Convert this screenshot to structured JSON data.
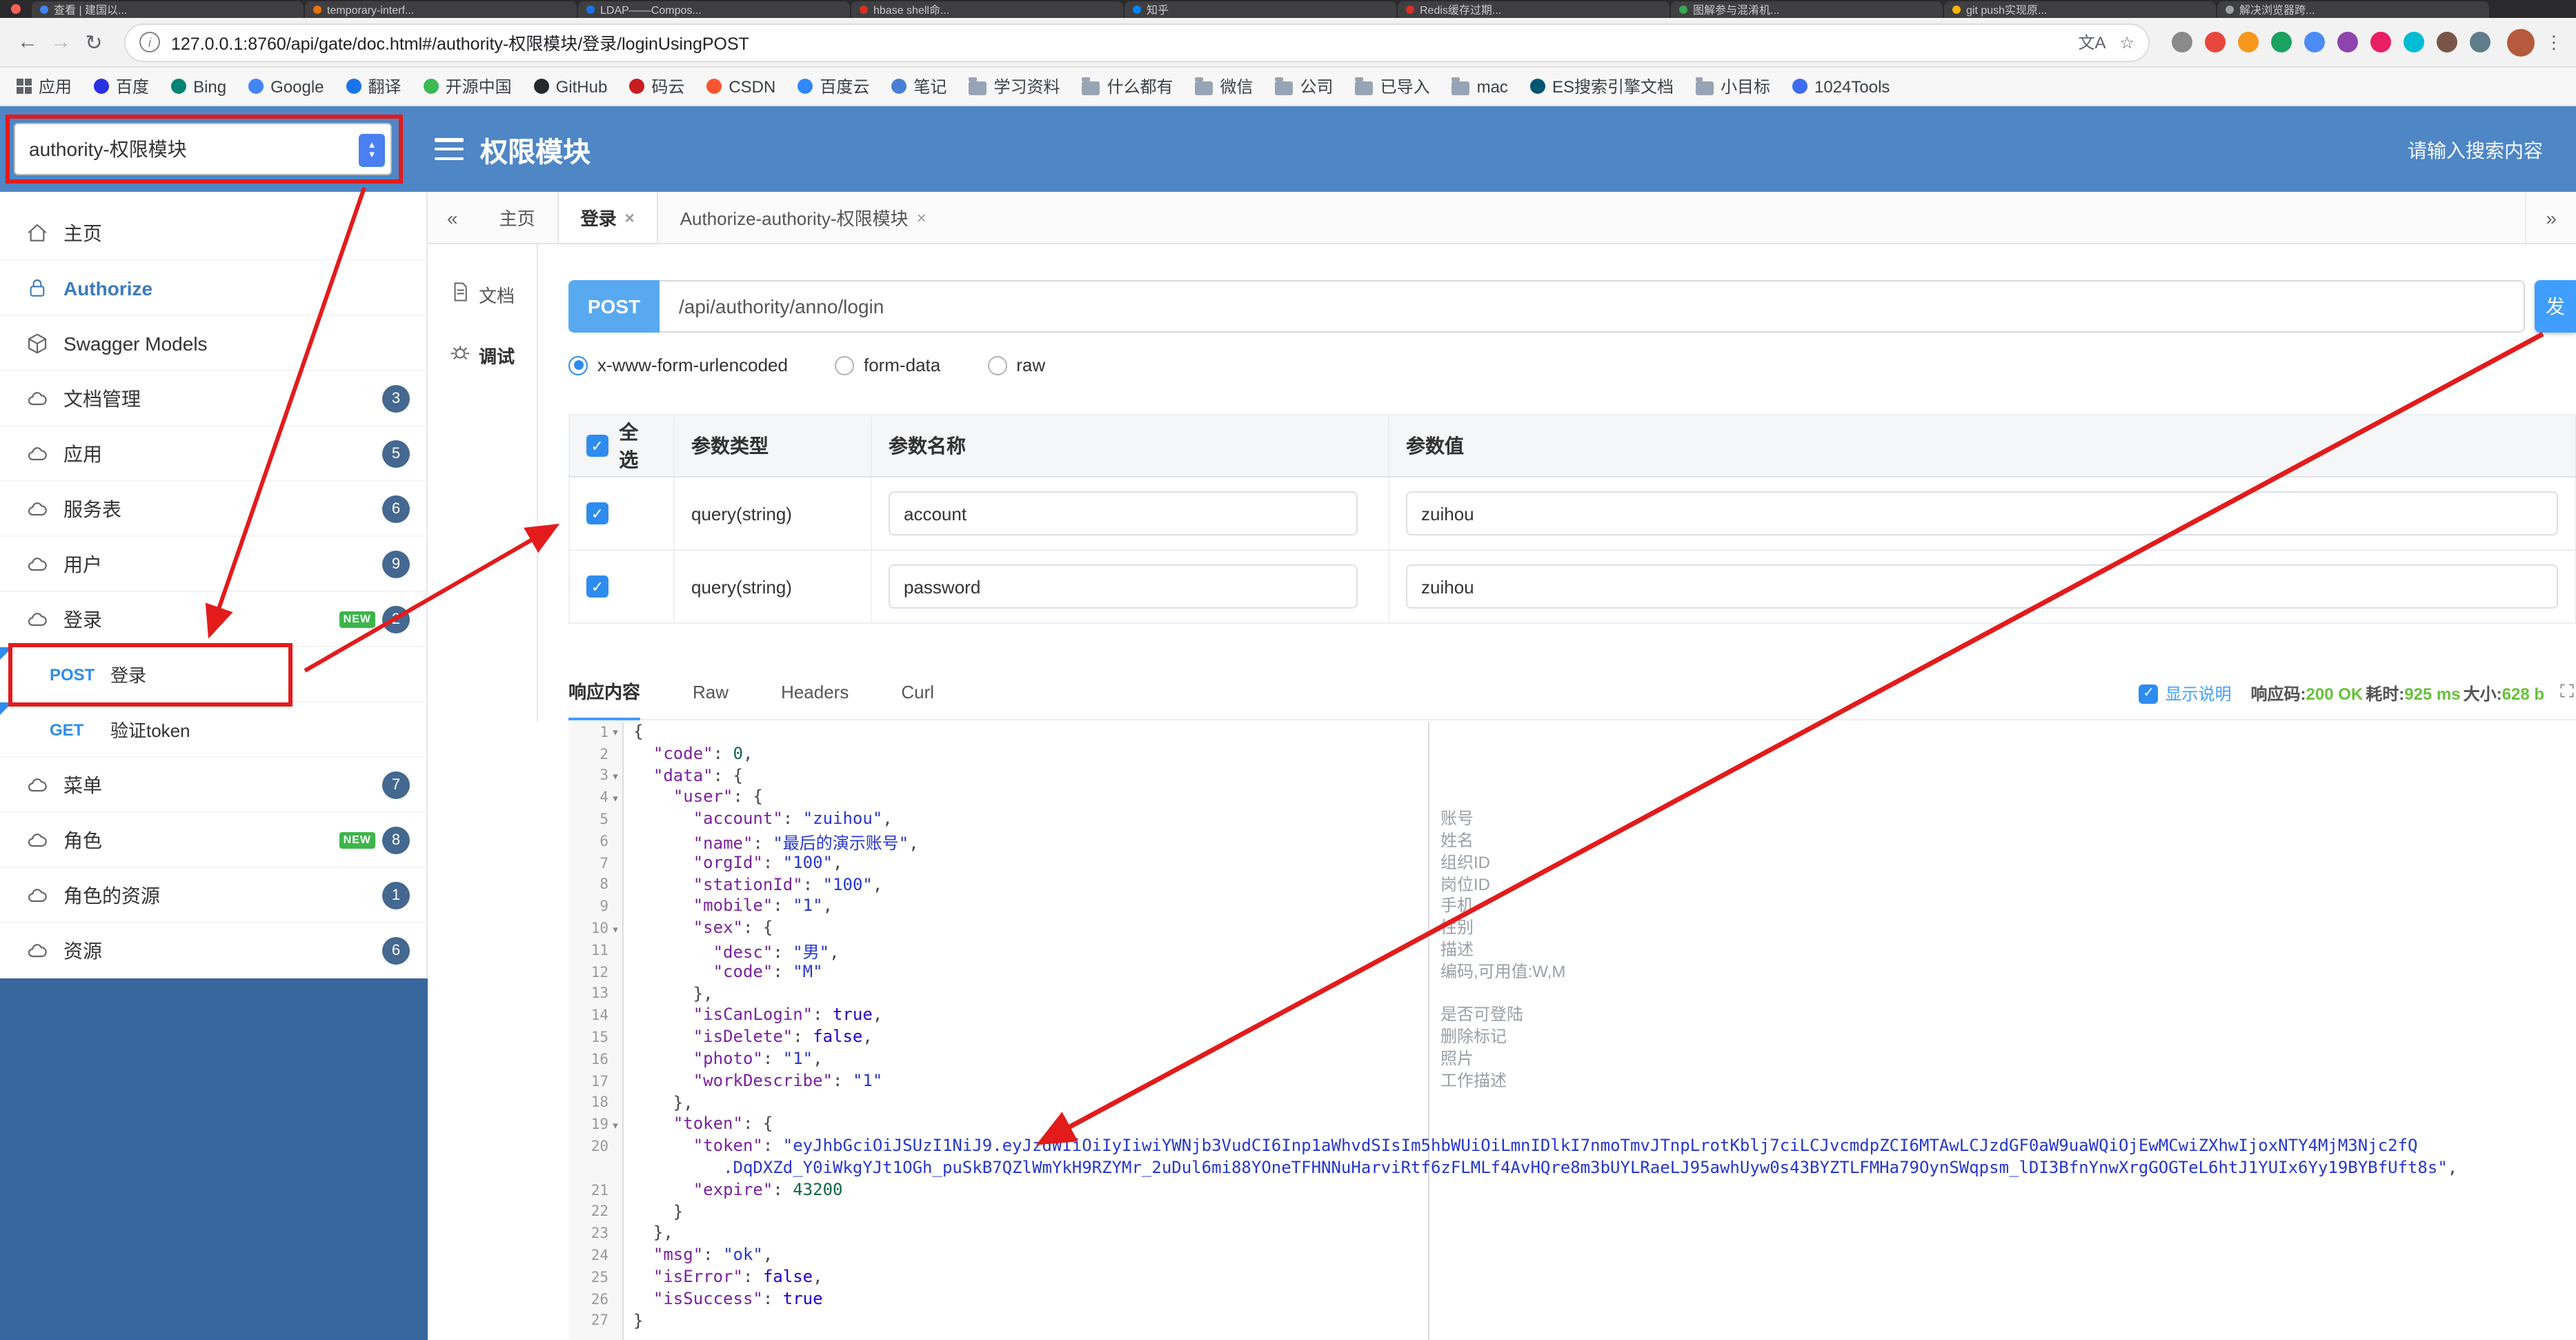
{
  "colors": {
    "header_blue": "#4e86c6",
    "sidebar_footer_blue": "#38679e",
    "accent_blue": "#409eff",
    "method_blue": "#2d8cf0",
    "success_green": "#67c23a",
    "annotation_red": "#e31b1b",
    "badge_blue": "#44688f",
    "new_green": "#3cb54a"
  },
  "browser": {
    "tabs": [
      {
        "title": "查看 | 建国以...",
        "color": "#4285f4"
      },
      {
        "title": "temporary-interf...",
        "color": "#e8710a"
      },
      {
        "title": "LDAP——Compos...",
        "color": "#1a73e8"
      },
      {
        "title": "hbase shell命...",
        "color": "#d93025"
      },
      {
        "title": "知乎",
        "color": "#0084ff"
      },
      {
        "title": "Redis缓存过期...",
        "color": "#d93025"
      },
      {
        "title": "图解参与混淆机...",
        "color": "#34a853"
      },
      {
        "title": "git push实现原...",
        "color": "#f4b400"
      },
      {
        "title": "解决浏览器跨...",
        "color": "#9aa0a6"
      }
    ],
    "address": {
      "url": "127.0.0.1:8760/api/gate/doc.html#/authority-权限模块/登录/loginUsingPOST"
    },
    "extensions": [
      "#8a8a8a",
      "#e8453c",
      "#f7981d",
      "#1aa260",
      "#4c8bf5",
      "#8e44ad",
      "#e91e63",
      "#00bcd4",
      "#795548",
      "#607d8b"
    ],
    "bookmarks": [
      {
        "label": "应用",
        "type": "apps"
      },
      {
        "label": "百度",
        "type": "site",
        "color": "#2932e1"
      },
      {
        "label": "Bing",
        "type": "site",
        "color": "#008373"
      },
      {
        "label": "Google",
        "type": "site",
        "color": "#4285f4"
      },
      {
        "label": "翻译",
        "type": "site",
        "color": "#1a73e8"
      },
      {
        "label": "开源中国",
        "type": "site",
        "color": "#3db954"
      },
      {
        "label": "GitHub",
        "type": "site",
        "color": "#24292e"
      },
      {
        "label": "码云",
        "type": "site",
        "color": "#c71d23"
      },
      {
        "label": "CSDN",
        "type": "site",
        "color": "#fc5531"
      },
      {
        "label": "百度云",
        "type": "site",
        "color": "#2f88ff"
      },
      {
        "label": "笔记",
        "type": "site",
        "color": "#4a7fd4"
      },
      {
        "label": "学习资料",
        "type": "folder"
      },
      {
        "label": "什么都有",
        "type": "folder"
      },
      {
        "label": "微信",
        "type": "folder"
      },
      {
        "label": "公司",
        "type": "folder"
      },
      {
        "label": "已导入",
        "type": "folder"
      },
      {
        "label": "mac",
        "type": "folder"
      },
      {
        "label": "ES搜索引擎文档",
        "type": "site",
        "color": "#005571"
      },
      {
        "label": "小目标",
        "type": "folder"
      },
      {
        "label": "1024Tools",
        "type": "site",
        "color": "#3c6df0"
      }
    ]
  },
  "header": {
    "module_select": "authority-权限模块",
    "title": "权限模块",
    "search_placeholder": "请输入搜索内容"
  },
  "sidebar": {
    "items": [
      {
        "label": "主页",
        "icon": "home"
      },
      {
        "label": "Authorize",
        "icon": "lock",
        "accent": true
      },
      {
        "label": "Swagger Models",
        "icon": "cube"
      },
      {
        "label": "文档管理",
        "icon": "cloud",
        "badge": "3"
      },
      {
        "label": "应用",
        "icon": "cloud",
        "badge": "5"
      },
      {
        "label": "服务表",
        "icon": "cloud",
        "badge": "6"
      },
      {
        "label": "用户",
        "icon": "cloud",
        "badge": "9"
      },
      {
        "label": "登录",
        "icon": "cloud",
        "badge": "2",
        "isNew": true
      },
      {
        "child": true,
        "method": "POST",
        "label": "登录"
      },
      {
        "child": true,
        "method": "GET",
        "label": "验证token"
      },
      {
        "label": "菜单",
        "icon": "cloud",
        "badge": "7"
      },
      {
        "label": "角色",
        "icon": "cloud",
        "badge": "8",
        "isNew": true
      },
      {
        "label": "角色的资源",
        "icon": "cloud",
        "badge": "1"
      },
      {
        "label": "资源",
        "icon": "cloud",
        "badge": "6"
      }
    ]
  },
  "doc_tabs": {
    "left_chevron": "«",
    "right_chevron": "»",
    "tabs": [
      {
        "label": "主页",
        "closable": false,
        "active": false
      },
      {
        "label": "登录",
        "closable": true,
        "active": true
      },
      {
        "label": "Authorize-authority-权限模块",
        "closable": true,
        "active": false
      }
    ]
  },
  "side_tabs": [
    {
      "label": "文档",
      "icon": "doc",
      "active": false
    },
    {
      "label": "调试",
      "icon": "debug",
      "active": true
    }
  ],
  "request": {
    "method": "POST",
    "url": "/api/authority/anno/login",
    "send_label": "发",
    "content_types": [
      {
        "label": "x-www-form-urlencoded",
        "selected": true
      },
      {
        "label": "form-data",
        "selected": false
      },
      {
        "label": "raw",
        "selected": false
      }
    ]
  },
  "params_table": {
    "headers": {
      "select_all": "全选",
      "type": "参数类型",
      "name": "参数名称",
      "value": "参数值"
    },
    "rows": [
      {
        "checked": true,
        "type": "query(string)",
        "name": "account",
        "value": "zuihou"
      },
      {
        "checked": true,
        "type": "query(string)",
        "name": "password",
        "value": "zuihou"
      }
    ]
  },
  "response": {
    "tabs": [
      {
        "label": "响应内容",
        "active": true
      },
      {
        "label": "Raw",
        "active": false
      },
      {
        "label": "Headers",
        "active": false
      },
      {
        "label": "Curl",
        "active": false
      }
    ],
    "show_desc_label": "显示说明",
    "show_desc_checked": true,
    "meta": [
      {
        "label": "响应码:",
        "value": "200 OK"
      },
      {
        "label": "耗时:",
        "value": "925 ms"
      },
      {
        "label": "大小:",
        "value": "628 b"
      }
    ]
  },
  "code": {
    "lines": [
      {
        "n": 1,
        "fold": true,
        "tokens": [
          [
            "p",
            "{"
          ]
        ]
      },
      {
        "n": 2,
        "tokens": [
          [
            "p",
            "  "
          ],
          [
            "k",
            "\"code\""
          ],
          [
            "p",
            ": "
          ],
          [
            "n",
            "0"
          ],
          [
            "p",
            ","
          ]
        ]
      },
      {
        "n": 3,
        "fold": true,
        "tokens": [
          [
            "p",
            "  "
          ],
          [
            "k",
            "\"data\""
          ],
          [
            "p",
            ": {"
          ]
        ]
      },
      {
        "n": 4,
        "fold": true,
        "tokens": [
          [
            "p",
            "    "
          ],
          [
            "k",
            "\"user\""
          ],
          [
            "p",
            ": {"
          ]
        ]
      },
      {
        "n": 5,
        "tokens": [
          [
            "p",
            "      "
          ],
          [
            "k",
            "\"account\""
          ],
          [
            "p",
            ": "
          ],
          [
            "s",
            "\"zuihou\""
          ],
          [
            "p",
            ","
          ]
        ]
      },
      {
        "n": 6,
        "tokens": [
          [
            "p",
            "      "
          ],
          [
            "k",
            "\"name\""
          ],
          [
            "p",
            ": "
          ],
          [
            "s",
            "\"最后的演示账号\""
          ],
          [
            "p",
            ","
          ]
        ]
      },
      {
        "n": 7,
        "tokens": [
          [
            "p",
            "      "
          ],
          [
            "k",
            "\"orgId\""
          ],
          [
            "p",
            ": "
          ],
          [
            "s",
            "\"100\""
          ],
          [
            "p",
            ","
          ]
        ]
      },
      {
        "n": 8,
        "tokens": [
          [
            "p",
            "      "
          ],
          [
            "k",
            "\"stationId\""
          ],
          [
            "p",
            ": "
          ],
          [
            "s",
            "\"100\""
          ],
          [
            "p",
            ","
          ]
        ]
      },
      {
        "n": 9,
        "tokens": [
          [
            "p",
            "      "
          ],
          [
            "k",
            "\"mobile\""
          ],
          [
            "p",
            ": "
          ],
          [
            "s",
            "\"1\""
          ],
          [
            "p",
            ","
          ]
        ]
      },
      {
        "n": 10,
        "fold": true,
        "tokens": [
          [
            "p",
            "      "
          ],
          [
            "k",
            "\"sex\""
          ],
          [
            "p",
            ": {"
          ]
        ]
      },
      {
        "n": 11,
        "tokens": [
          [
            "p",
            "        "
          ],
          [
            "k",
            "\"desc\""
          ],
          [
            "p",
            ": "
          ],
          [
            "s",
            "\"男\""
          ],
          [
            "p",
            ","
          ]
        ]
      },
      {
        "n": 12,
        "tokens": [
          [
            "p",
            "        "
          ],
          [
            "k",
            "\"code\""
          ],
          [
            "p",
            ": "
          ],
          [
            "s",
            "\"M\""
          ]
        ]
      },
      {
        "n": 13,
        "tokens": [
          [
            "p",
            "      },"
          ]
        ]
      },
      {
        "n": 14,
        "tokens": [
          [
            "p",
            "      "
          ],
          [
            "k",
            "\"isCanLogin\""
          ],
          [
            "p",
            ": "
          ],
          [
            "b",
            "true"
          ],
          [
            "p",
            ","
          ]
        ]
      },
      {
        "n": 15,
        "tokens": [
          [
            "p",
            "      "
          ],
          [
            "k",
            "\"isDelete\""
          ],
          [
            "p",
            ": "
          ],
          [
            "b",
            "false"
          ],
          [
            "p",
            ","
          ]
        ]
      },
      {
        "n": 16,
        "tokens": [
          [
            "p",
            "      "
          ],
          [
            "k",
            "\"photo\""
          ],
          [
            "p",
            ": "
          ],
          [
            "s",
            "\"1\""
          ],
          [
            "p",
            ","
          ]
        ]
      },
      {
        "n": 17,
        "tokens": [
          [
            "p",
            "      "
          ],
          [
            "k",
            "\"workDescribe\""
          ],
          [
            "p",
            ": "
          ],
          [
            "s",
            "\"1\""
          ]
        ]
      },
      {
        "n": 18,
        "tokens": [
          [
            "p",
            "    },"
          ]
        ]
      },
      {
        "n": 19,
        "fold": true,
        "tokens": [
          [
            "p",
            "    "
          ],
          [
            "k",
            "\"token\""
          ],
          [
            "p",
            ": {"
          ]
        ]
      },
      {
        "n": 20,
        "tokens": [
          [
            "p",
            "      "
          ],
          [
            "k",
            "\"token\""
          ],
          [
            "p",
            ": "
          ],
          [
            "s",
            "\"eyJhbGciOiJSUzI1NiJ9.eyJzdWIiOiIyIiwiYWNjb3VudCI6Inp1aWhvdSIsIm5hbWUiOiLmnIDlkI7nmoTmvJTnpLrotKblj7ciLCJvcmdpZCI6MTAwLCJzdGF0aW9uaWQiOjEwMCwiZXhwIjoxNTY4MjM3Njc2fQ"
          ]
        ],
        "wrap": [
          [
            "p",
            "         "
          ],
          [
            "s",
            ".DqDXZd_Y0iWkgYJt1OGh_puSkB7QZlWmYkH9RZYMr_2uDul6mi88YOneTFHNNuHarviRtf6zFLMLf4AvHQre8m3bUYLRaeLJ95awhUyw0s43BYZTLFMHa79OynSWqpsm_lDI3BfnYnwXrgGOGTeL6htJ1YUIx6Yy19BYBfUft8s\""
          ],
          [
            "p",
            ","
          ]
        ]
      },
      {
        "n": 21,
        "tokens": [
          [
            "p",
            "      "
          ],
          [
            "k",
            "\"expire\""
          ],
          [
            "p",
            ": "
          ],
          [
            "n",
            "43200"
          ]
        ]
      },
      {
        "n": 22,
        "tokens": [
          [
            "p",
            "    }"
          ]
        ]
      },
      {
        "n": 23,
        "tokens": [
          [
            "p",
            "  },"
          ]
        ]
      },
      {
        "n": 24,
        "tokens": [
          [
            "p",
            "  "
          ],
          [
            "k",
            "\"msg\""
          ],
          [
            "p",
            ": "
          ],
          [
            "s",
            "\"ok\""
          ],
          [
            "p",
            ","
          ]
        ]
      },
      {
        "n": 25,
        "tokens": [
          [
            "p",
            "  "
          ],
          [
            "k",
            "\"isError\""
          ],
          [
            "p",
            ": "
          ],
          [
            "b",
            "false"
          ],
          [
            "p",
            ","
          ]
        ]
      },
      {
        "n": 26,
        "tokens": [
          [
            "p",
            "  "
          ],
          [
            "k",
            "\"isSuccess\""
          ],
          [
            "p",
            ": "
          ],
          [
            "b",
            "true"
          ]
        ]
      },
      {
        "n": 27,
        "tokens": [
          [
            "p",
            "}"
          ]
        ]
      }
    ],
    "annotations": [
      {
        "line": 5,
        "text": "账号"
      },
      {
        "line": 6,
        "text": "姓名"
      },
      {
        "line": 7,
        "text": "组织ID"
      },
      {
        "line": 8,
        "text": "岗位ID"
      },
      {
        "line": 9,
        "text": "手机"
      },
      {
        "line": 10,
        "text": "性别"
      },
      {
        "line": 11,
        "text": "描述"
      },
      {
        "line": 12,
        "text": "编码,可用值:W,M"
      },
      {
        "line": 14,
        "text": "是否可登陆"
      },
      {
        "line": 15,
        "text": "删除标记"
      },
      {
        "line": 16,
        "text": "照片"
      },
      {
        "line": 17,
        "text": "工作描述"
      }
    ]
  }
}
